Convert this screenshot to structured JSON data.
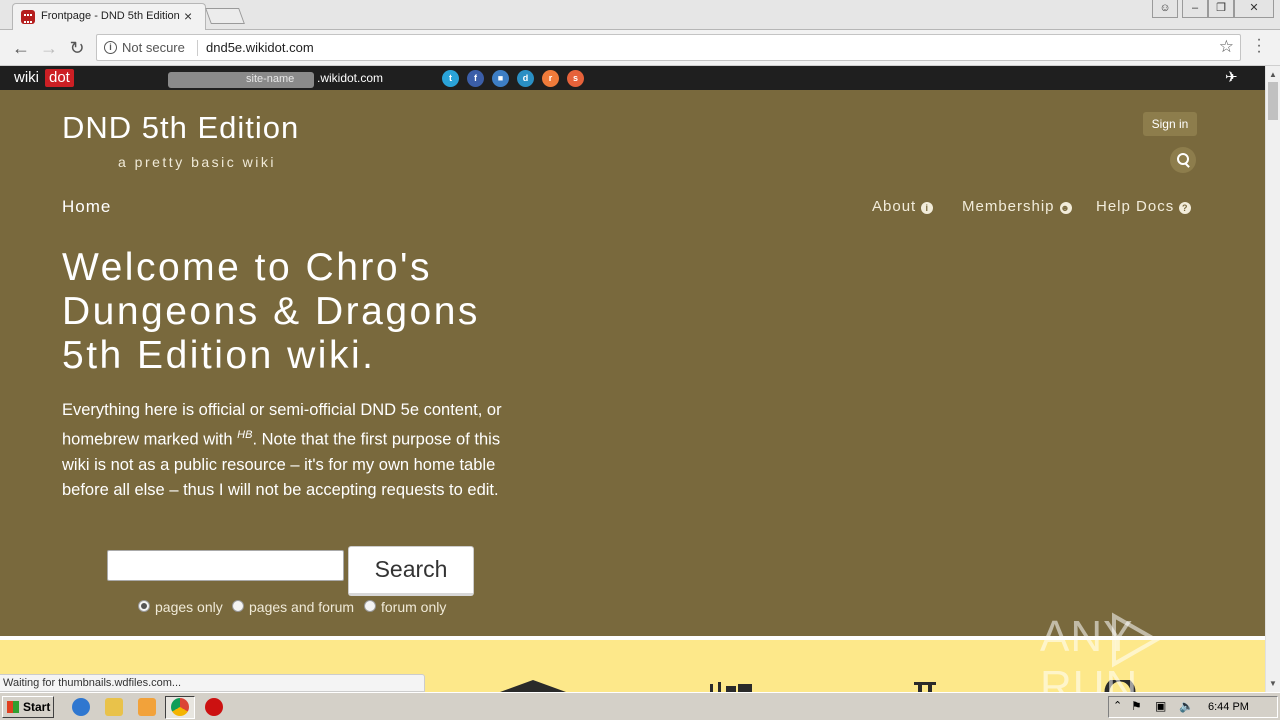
{
  "browser": {
    "tab_title": "Frontpage - DND 5th Edition",
    "tab_close": "×",
    "security_label": "Not secure",
    "url": "dnd5e.wikidot.com"
  },
  "wikidot_bar": {
    "logo_wiki": "wiki",
    "logo_dot": "dot",
    "site_name_placeholder": "site-name",
    "site_domain": ".wikidot.com",
    "share_icons": [
      "twitter-icon",
      "facebook-icon",
      "delicious-icon",
      "digg-icon",
      "reddit-icon",
      "stumbleupon-icon"
    ]
  },
  "header": {
    "site_title": "DND 5th Edition",
    "site_subtitle": "a pretty basic wiki",
    "sign_in": "Sign in"
  },
  "nav": {
    "home": "Home",
    "about": "About",
    "membership": "Membership",
    "help_docs": "Help Docs"
  },
  "main": {
    "welcome": "Welcome to Chro's Dungeons & Dragons 5th Edition wiki.",
    "intro_before": "Everything here is official or semi-official DND 5e content, or homebrew marked with ",
    "intro_sup": "HB",
    "intro_after": ". Note that the first purpose of this wiki is not as a public resource – it's for my own home table before all else – thus I will not be accepting requests to edit."
  },
  "search": {
    "button_label": "Search",
    "input_value": "",
    "options": [
      "pages only",
      "pages and forum",
      "forum only"
    ],
    "selected": "pages only"
  },
  "status_bar": {
    "text": "Waiting for thumbnails.wdfiles.com..."
  },
  "watermark": {
    "left": "ANY",
    "right": "RUN"
  },
  "taskbar": {
    "start_label": "Start",
    "clock": "6:44 PM"
  },
  "colors": {
    "page_background": "#79693d",
    "lower_band": "#fde88a",
    "wikidot_red": "#cc1f24"
  }
}
